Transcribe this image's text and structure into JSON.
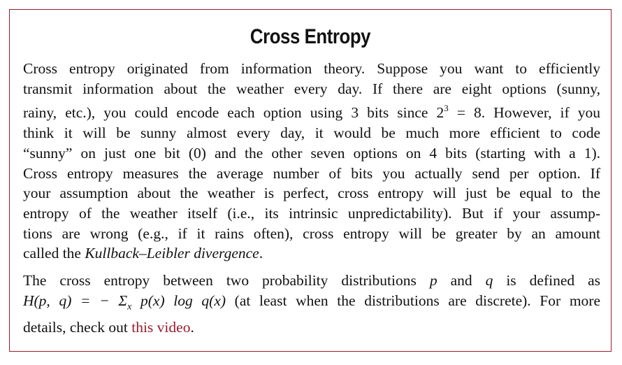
{
  "title": "Cross Entropy",
  "paragraph1": {
    "line1": "Cross entropy originated from information theory. Suppose you want to efficiently",
    "line2": "transmit information about the weather every day. If there are eight options (sunny,",
    "line3_a": "rainy, etc.), you could encode each option using 3 bits since 2",
    "line3_sup": "3",
    "line3_b": " = 8. However, if you",
    "line4": "think it will be sunny almost every day, it would be much more efficient to code",
    "line5": "“sunny” on just one bit (0) and the other seven options on 4 bits (starting with a 1).",
    "line6": "Cross entropy measures the average number of bits you actually send per option. If",
    "line7": "your assumption about the weather is perfect, cross entropy will just be equal to the",
    "line8": "entropy of the weather itself (i.e., its intrinsic unpredictability). But if your assump-",
    "line9": "tions are wrong (e.g., if it rains often), cross entropy will be greater by an amount",
    "line10_a": "called the ",
    "line10_em": "Kullback–Leibler divergence",
    "line10_b": "."
  },
  "paragraph2": {
    "line1_a": "The cross entropy between two probability distributions ",
    "line1_p": "p",
    "line1_b": " and ",
    "line1_q": "q",
    "line1_c": " is defined as",
    "line2_formula": "H(p, q) = − Σ",
    "line2_sub": "x",
    "line2_formula_b": " p(x) log q(x)",
    "line2_text": " (at least when the distributions are discrete). For more",
    "line3_a": "details, check out ",
    "line3_link": "this video",
    "line3_b": "."
  },
  "colors": {
    "border": "#9b1c2c",
    "link": "#9b1c2c",
    "text": "#111111"
  }
}
